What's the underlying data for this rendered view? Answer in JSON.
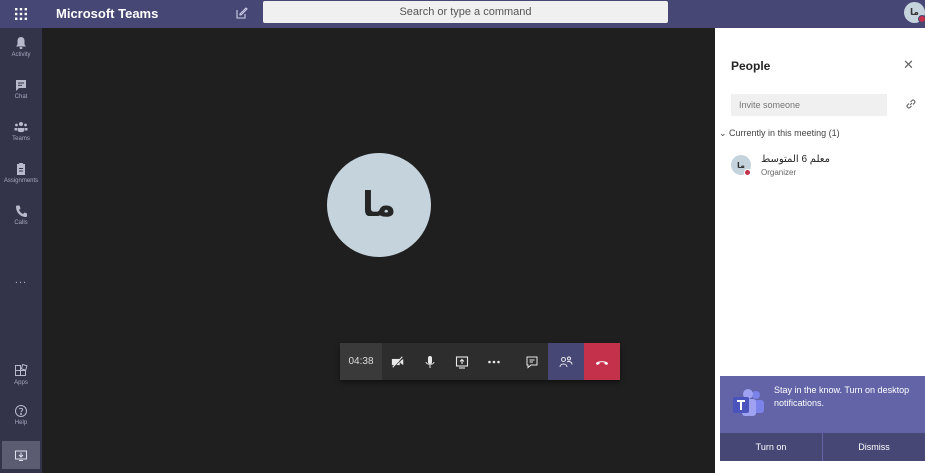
{
  "app": {
    "title": "Microsoft Teams"
  },
  "search": {
    "placeholder": "Search or type a command"
  },
  "user": {
    "avatar_initials": "ما"
  },
  "rail": {
    "items": [
      {
        "label": "Activity",
        "icon": "bell-icon"
      },
      {
        "label": "Chat",
        "icon": "chat-icon"
      },
      {
        "label": "Teams",
        "icon": "teams-icon"
      },
      {
        "label": "Assignments",
        "icon": "assignments-icon"
      },
      {
        "label": "Calls",
        "icon": "phone-icon"
      },
      {
        "label": "Apps",
        "icon": "apps-icon"
      },
      {
        "label": "Help",
        "icon": "help-icon"
      }
    ],
    "more": "..."
  },
  "call": {
    "participant_initials": "ما",
    "timer": "04:38"
  },
  "people_panel": {
    "title": "People",
    "invite_placeholder": "Invite someone",
    "section_label": "Currently in this meeting (1)",
    "participants": [
      {
        "initials": "ما",
        "name": "معلم 6 المتوسط",
        "role": "Organizer"
      }
    ]
  },
  "toast": {
    "message": "Stay in the know. Turn on desktop notifications.",
    "turn_on": "Turn on",
    "dismiss": "Dismiss"
  },
  "colors": {
    "brand": "#464775",
    "accent": "#6264a7",
    "hangup": "#c4314b",
    "stage": "#1f1f1f",
    "rail": "#33344a"
  }
}
